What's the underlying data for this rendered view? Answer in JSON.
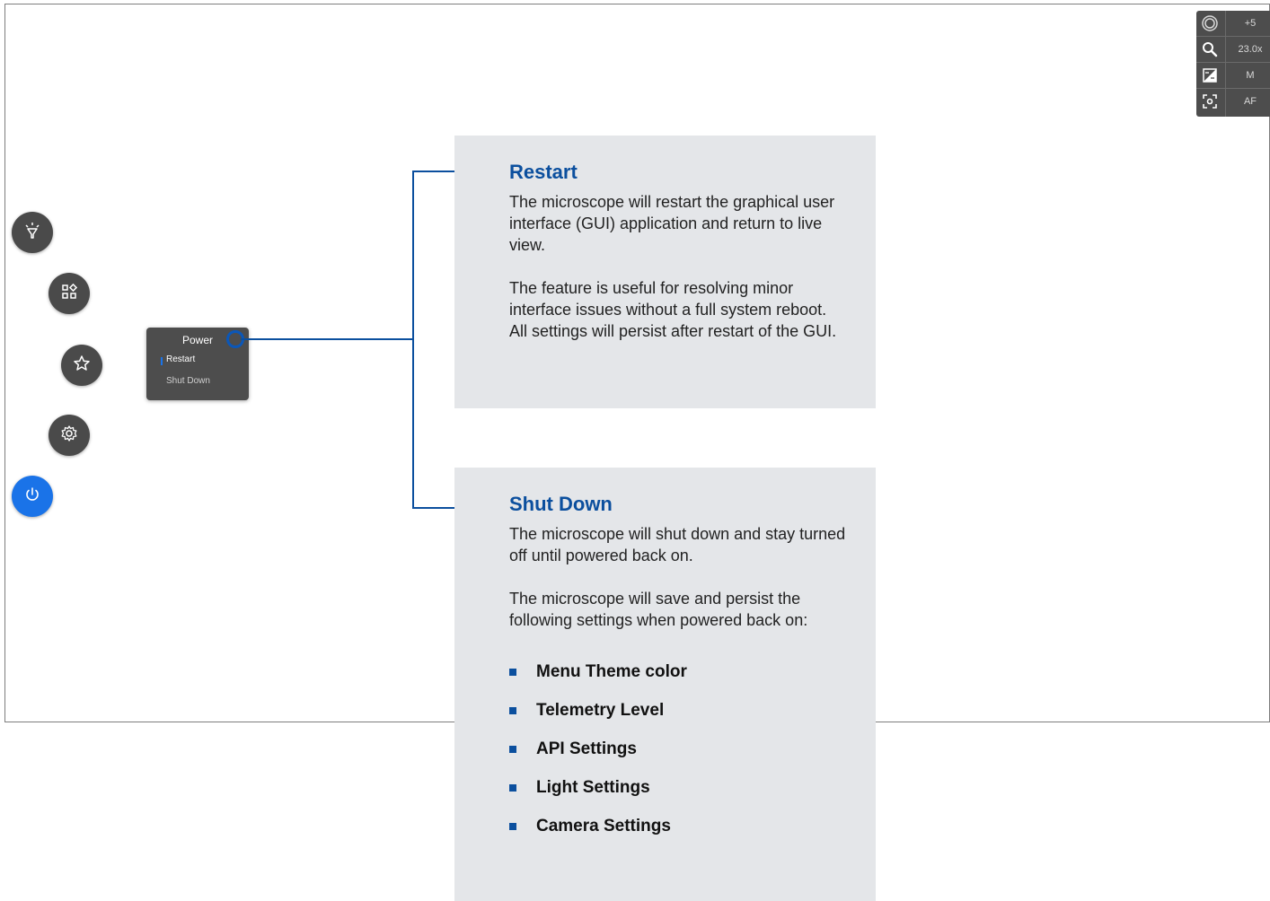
{
  "status_panel": {
    "rows": [
      {
        "icon": "aperture-icon",
        "value": "+5"
      },
      {
        "icon": "magnifier-icon",
        "value": "23.0x"
      },
      {
        "icon": "exposure-icon",
        "value": "M"
      },
      {
        "icon": "focus-icon",
        "value": "AF"
      }
    ]
  },
  "left_menu": {
    "buttons": [
      {
        "name": "light-button",
        "icon": "lamp-icon"
      },
      {
        "name": "apps-button",
        "icon": "apps-icon"
      },
      {
        "name": "favorites-button",
        "icon": "star-icon"
      },
      {
        "name": "settings-button",
        "icon": "gear-icon"
      },
      {
        "name": "power-button",
        "icon": "power-icon",
        "active": true
      }
    ]
  },
  "power_menu": {
    "title": "Power",
    "items": [
      "Restart",
      "Shut Down"
    ],
    "selected": "Restart"
  },
  "restart_box": {
    "title": "Restart",
    "text1": "The microscope will restart the graphical user interface (GUI) application and return to live view.",
    "text2": "The feature is useful for resolving minor interface issues without a full system reboot.\nAll settings will persist after restart of the GUI."
  },
  "shutdown_box": {
    "title": "Shut Down",
    "text1": "The microscope will shut down and stay turned off until powered back on.",
    "text2": "The microscope will save and persist the following settings when powered back on:",
    "bullets": [
      "Menu Theme color",
      "Telemetry Level",
      "API Settings",
      "Light Settings",
      "Camera Settings"
    ]
  },
  "colors": {
    "accent": "#1a73e8",
    "title_blue": "#0b4f9e",
    "panel_dark": "#4d4d4d",
    "box_bg": "#e4e6e9"
  }
}
